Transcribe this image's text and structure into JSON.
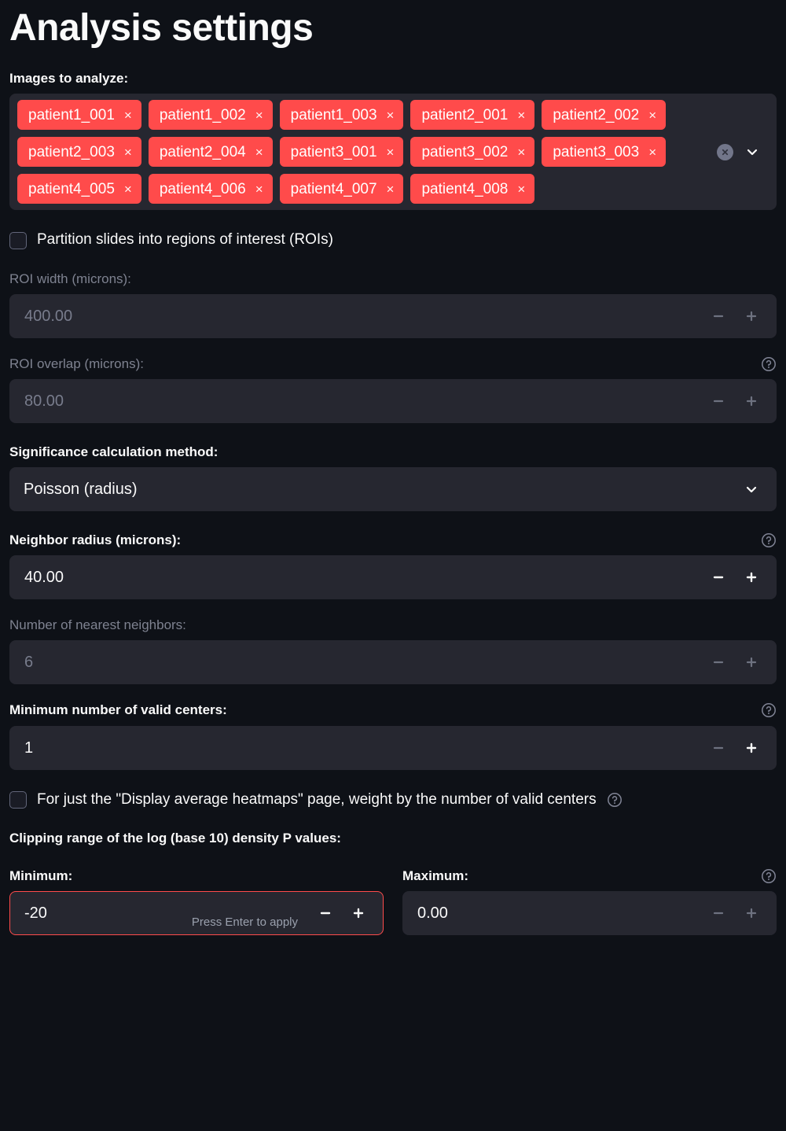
{
  "page_title": "Analysis settings",
  "images_section": {
    "label": "Images to analyze:",
    "tags": [
      "patient1_001",
      "patient1_002",
      "patient1_003",
      "patient2_001",
      "patient2_002",
      "patient2_003",
      "patient2_004",
      "patient3_001",
      "patient3_002",
      "patient3_003",
      "patient4_005",
      "patient4_006",
      "patient4_007",
      "patient4_008"
    ],
    "tag_remove_glyph": "×",
    "clear_all_icon": "clear-circle-icon",
    "dropdown_icon": "chevron-down-icon"
  },
  "partition_checkbox": {
    "label": "Partition slides into regions of interest (ROIs)",
    "checked": false
  },
  "roi_width": {
    "label": "ROI width (microns):",
    "value": "400.00",
    "disabled": true,
    "has_help": false
  },
  "roi_overlap": {
    "label": "ROI overlap (microns):",
    "value": "80.00",
    "disabled": true,
    "has_help": true
  },
  "significance_method": {
    "label": "Significance calculation method:",
    "value": "Poisson (radius)"
  },
  "neighbor_radius": {
    "label": "Neighbor radius (microns):",
    "value": "40.00",
    "disabled": false,
    "has_help": true
  },
  "nearest_neighbors": {
    "label": "Number of nearest neighbors:",
    "value": "6",
    "disabled": true,
    "has_help": false
  },
  "min_valid_centers": {
    "label": "Minimum number of valid centers:",
    "value": "1",
    "disabled": false,
    "has_help": true,
    "minus_dimmed": true,
    "plus_dimmed": false
  },
  "weight_checkbox": {
    "label": "For just the \"Display average heatmaps\" page, weight by the number of valid centers",
    "checked": false,
    "has_help": true
  },
  "clipping_range": {
    "label": "Clipping range of the log (base 10) density P values:",
    "minimum": {
      "label": "Minimum:",
      "value": "-20",
      "hint": "Press Enter to apply",
      "focused": true
    },
    "maximum": {
      "label": "Maximum:",
      "value": "0.00",
      "has_help": true,
      "minus_dimmed": true,
      "plus_dimmed": true
    }
  },
  "colors": {
    "background": "#0e1117",
    "surface": "#262730",
    "accent_red": "#ff4b4b",
    "text": "#fafafa",
    "text_muted": "#7e8290"
  }
}
